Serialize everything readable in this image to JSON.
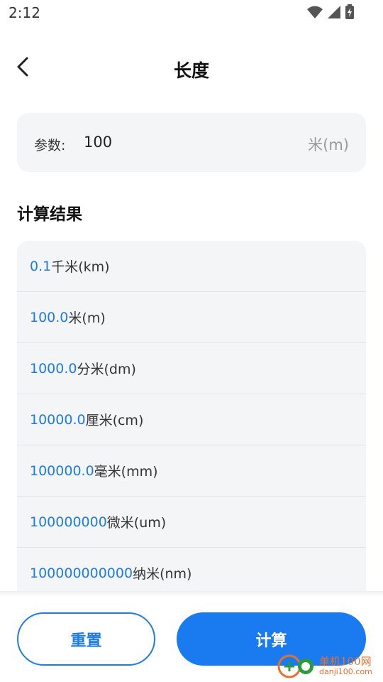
{
  "status_bar": {
    "time": "2:12",
    "icons": [
      "wifi-icon",
      "signal-icon",
      "battery-icon"
    ]
  },
  "header": {
    "back_icon": "chevron-left-icon",
    "title": "长度"
  },
  "param": {
    "label": "参数:",
    "value": "100",
    "unit": "米(m)"
  },
  "results": {
    "title": "计算结果",
    "items": [
      {
        "value": "0.1",
        "unit": "千米(km)"
      },
      {
        "value": "100.0",
        "unit": "米(m)"
      },
      {
        "value": "1000.0",
        "unit": "分米(dm)"
      },
      {
        "value": "10000.0",
        "unit": "厘米(cm)"
      },
      {
        "value": "100000.0",
        "unit": "毫米(mm)"
      },
      {
        "value": "100000000",
        "unit": "微米(um)"
      },
      {
        "value": "100000000000",
        "unit": "纳米(nm)"
      }
    ]
  },
  "actions": {
    "reset_label": "重置",
    "calculate_label": "计算"
  },
  "watermark": {
    "cn": "单机100网",
    "en": "danji100.com"
  },
  "colors": {
    "accent": "#1f7be6",
    "button_primary": "#1a7bf0",
    "card_bg": "#f4f5f7",
    "watermark": "#e8702a"
  }
}
